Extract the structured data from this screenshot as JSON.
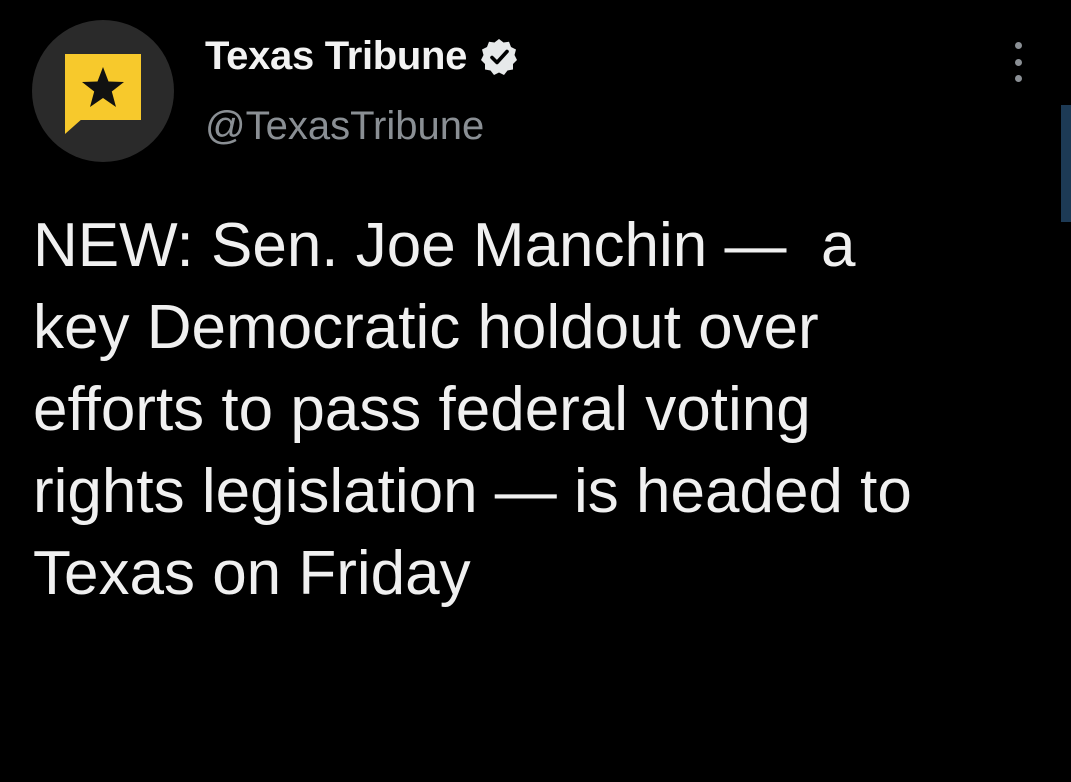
{
  "tweet": {
    "author": {
      "display_name": "Texas Tribune",
      "handle": "@TexasTribune",
      "verified": true,
      "avatar_icon": "star-speech-bubble-logo",
      "brand_color": "#f7c92c"
    },
    "text": "NEW: Sen. Joe Manchin —  a\nkey Democratic holdout over\nefforts to pass federal voting\nrights legislation — is headed to\nTexas on Friday",
    "more_icon": "more-vertical-icon"
  },
  "theme": {
    "background": "#000000",
    "text_color": "#f0f0f0",
    "secondary_text_color": "#8a8f94",
    "verified_badge_color": "#e7e9ea"
  }
}
